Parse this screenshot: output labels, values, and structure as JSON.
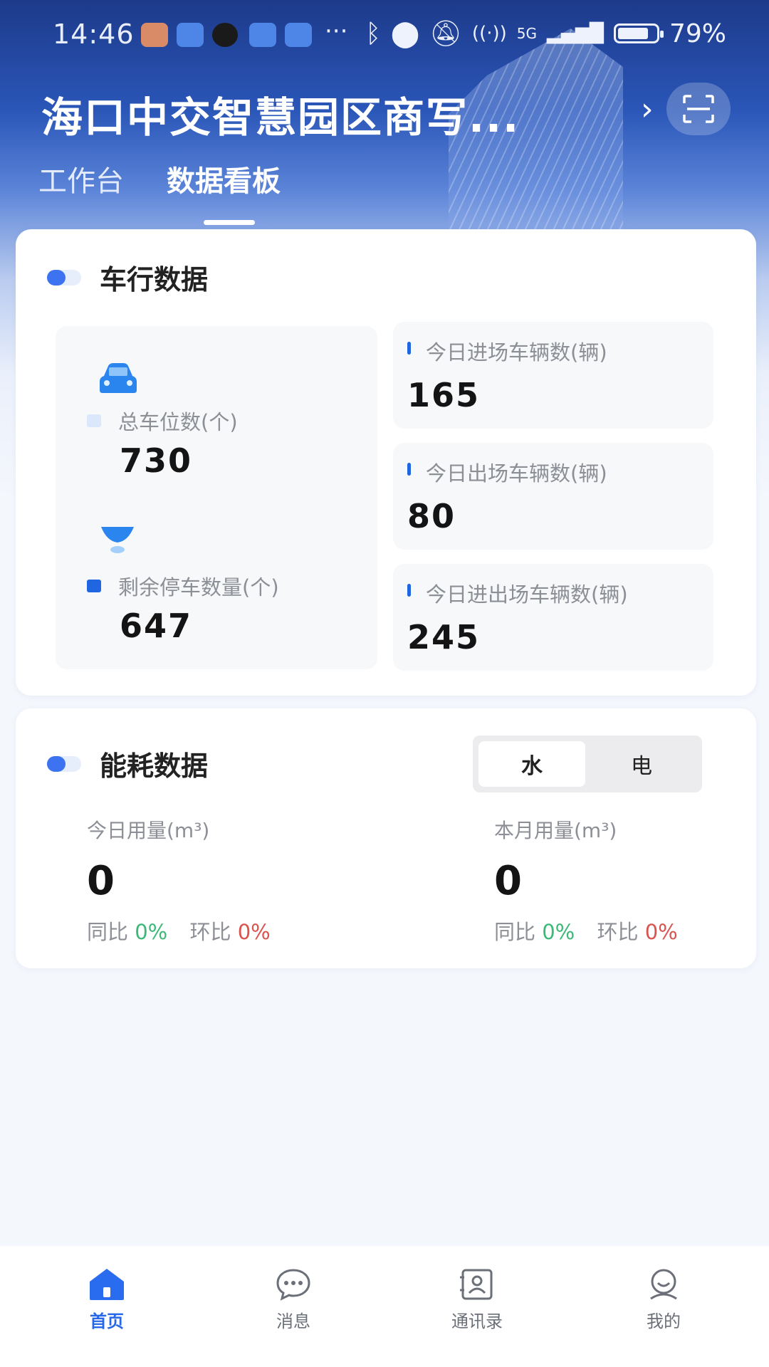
{
  "status_bar": {
    "time": "14:46",
    "network": "5G",
    "battery": "79%"
  },
  "header": {
    "title": "海口中交智慧园区商写...",
    "tabs": [
      {
        "label": "工作台",
        "active": false
      },
      {
        "label": "数据看板",
        "active": true
      }
    ]
  },
  "traffic": {
    "title": "车行数据",
    "total_spaces": {
      "label": "总车位数(个)",
      "value": "730"
    },
    "remaining_spaces": {
      "label": "剩余停车数量(个)",
      "value": "647"
    },
    "stats": [
      {
        "label": "今日进场车辆数(辆)",
        "value": "165"
      },
      {
        "label": "今日出场车辆数(辆)",
        "value": "80"
      },
      {
        "label": "今日进出场车辆数(辆)",
        "value": "245"
      }
    ]
  },
  "energy": {
    "title": "能耗数据",
    "toggle": {
      "water": "水",
      "electric": "电",
      "selected": "水"
    },
    "today": {
      "label": "今日用量(m³)",
      "value": "0",
      "yoy_label": "同比",
      "yoy": "0%",
      "mom_label": "环比",
      "mom": "0%"
    },
    "month": {
      "label": "本月用量(m³)",
      "value": "0",
      "yoy_label": "同比",
      "yoy": "0%",
      "mom_label": "环比",
      "mom": "0%"
    }
  },
  "nav": [
    {
      "label": "首页",
      "icon": "home-icon",
      "active": true
    },
    {
      "label": "消息",
      "icon": "chat-icon",
      "active": false
    },
    {
      "label": "通讯录",
      "icon": "contacts-icon",
      "active": false
    },
    {
      "label": "我的",
      "icon": "profile-icon",
      "active": false
    }
  ],
  "colors": {
    "accent": "#2868e6",
    "positive": "#3cb878",
    "negative": "#d9534f"
  }
}
